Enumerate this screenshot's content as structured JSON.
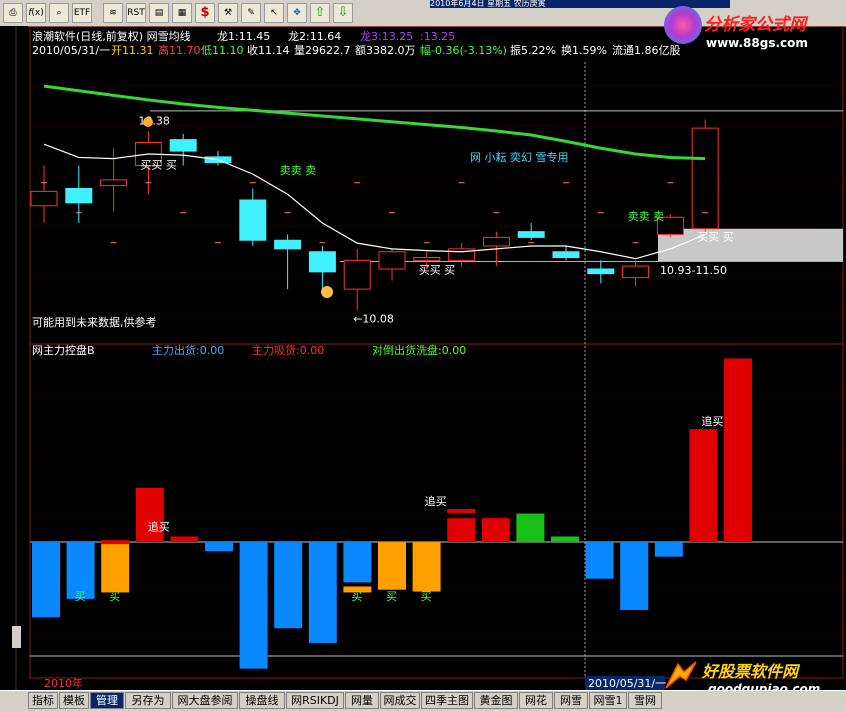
{
  "window": {
    "title": "2010年6月4日 星期五 农历庚寅"
  },
  "toolbar": {
    "icons": [
      "print-icon",
      "fx-icon",
      "search-icon",
      "etf-icon",
      "indicator-icon",
      "rst-icon",
      "data-icon",
      "dollar-icon",
      "tools-icon",
      "pen-icon",
      "arrow-icon",
      "move-icon",
      "up-arrow-icon",
      "down-arrow-icon"
    ],
    "etf_label": "ETF",
    "rst_label": "RST",
    "dollar_label": "$"
  },
  "header": {
    "row1": "浪潮软件(日线,前复权) 网雪均线",
    "long1": "龙1:11.45",
    "long2": "龙2:11.64",
    "long3": "龙3:13.25",
    "long4": ":13.25",
    "date": "2010/05/31/一",
    "open": "开11.31",
    "high": "高11.70",
    "low": "低11.10",
    "close": "收11.14",
    "volume": "量29622.7",
    "amount": "额3382.0万",
    "change": "幅-0.36(-3.13%)",
    "swing": "振5.22%",
    "turnover": "换1.59%",
    "float": "流通1.86亿股"
  },
  "annotations": {
    "future_note": "可能用到未来数据,供参考",
    "netname": "网 小耘 奕幻 雪专用",
    "high_mark": "13.38",
    "low_mark": "←10.08",
    "range_label": "10.93-11.50",
    "buy": "买",
    "sell": "卖",
    "chase": "追买"
  },
  "lower": {
    "title": "网主力控盘B",
    "out_label": "主力出货:0.00",
    "in_label": "主力吸货:0.00",
    "wash_label": "对倒出货洗盘:0.00"
  },
  "footer": {
    "year": "2010年",
    "cursor_date": "2010/05/31/一"
  },
  "tabs": [
    "指标",
    "模板",
    "管理",
    "另存为",
    "网大盘参阅",
    "操盘线",
    "网RSIKDJ",
    "网量",
    "网成交",
    "四季主图",
    "黄金图",
    "网花",
    "网雪",
    "网雪1",
    "雪网"
  ],
  "active_tab": "管理",
  "brands": {
    "top_name": "分析家公式网",
    "top_url": "www.88gs.com",
    "bottom_name": "好股票软件网",
    "bottom_url": "goodgupiao.com"
  },
  "colors": {
    "up": "#ff3030",
    "down": "#40f0ff",
    "ma_green": "#35d835",
    "line_white": "#ffffff",
    "bar_red": "#e00000",
    "bar_blue": "#0a88ff",
    "bar_orange": "#ffa000",
    "bar_green": "#18c018"
  },
  "chart_data": [
    {
      "type": "candlestick",
      "title": "浪潮软件(日线,前复权)",
      "ylim": [
        9.6,
        14.4
      ],
      "candles": [
        {
          "o": 11.9,
          "h": 12.6,
          "l": 11.6,
          "c": 12.15
        },
        {
          "o": 12.2,
          "h": 12.6,
          "l": 11.6,
          "c": 11.95
        },
        {
          "o": 12.25,
          "h": 12.9,
          "l": 11.8,
          "c": 12.35
        },
        {
          "o": 12.6,
          "h": 13.2,
          "l": 12.1,
          "c": 13.0
        },
        {
          "o": 13.05,
          "h": 13.15,
          "l": 12.6,
          "c": 12.85
        },
        {
          "o": 12.75,
          "h": 12.85,
          "l": 12.6,
          "c": 12.65
        },
        {
          "o": 12.0,
          "h": 12.2,
          "l": 11.2,
          "c": 11.3
        },
        {
          "o": 11.3,
          "h": 11.4,
          "l": 10.45,
          "c": 11.15
        },
        {
          "o": 11.1,
          "h": 11.2,
          "l": 10.4,
          "c": 10.75
        },
        {
          "o": 10.45,
          "h": 11.15,
          "l": 10.08,
          "c": 10.95
        },
        {
          "o": 10.8,
          "h": 11.15,
          "l": 10.6,
          "c": 11.1
        },
        {
          "o": 10.95,
          "h": 11.1,
          "l": 10.8,
          "c": 11.0
        },
        {
          "o": 10.95,
          "h": 11.25,
          "l": 10.85,
          "c": 11.15
        },
        {
          "o": 11.2,
          "h": 11.45,
          "l": 10.85,
          "c": 11.35
        },
        {
          "o": 11.45,
          "h": 11.6,
          "l": 11.3,
          "c": 11.35
        },
        {
          "o": 11.1,
          "h": 11.2,
          "l": 10.95,
          "c": 11.0
        },
        {
          "o": 10.8,
          "h": 10.95,
          "l": 10.55,
          "c": 10.72
        },
        {
          "o": 10.65,
          "h": 10.95,
          "l": 10.5,
          "c": 10.85
        },
        {
          "o": 11.4,
          "h": 11.75,
          "l": 11.35,
          "c": 11.7
        },
        {
          "o": 11.5,
          "h": 13.4,
          "l": 11.45,
          "c": 13.25
        }
      ],
      "series": [
        {
          "values": [
            12.97,
            12.74,
            12.72,
            12.8,
            12.78,
            12.7,
            12.45,
            12.1,
            11.6,
            11.25,
            11.15,
            11.12,
            11.1,
            11.15,
            11.2,
            11.2,
            11.1,
            10.98,
            11.15,
            11.4
          ]
        },
        {
          "values": [
            13.98,
            13.9,
            13.82,
            13.74,
            13.67,
            13.61,
            13.56,
            13.51,
            13.46,
            13.41,
            13.36,
            13.31,
            13.26,
            13.2,
            13.13,
            13.02,
            12.9,
            12.8,
            12.74,
            12.72
          ]
        }
      ],
      "reference_lines": [
        11.6,
        10.93,
        11.5
      ],
      "signals": [
        {
          "i": 3,
          "text": "买买 买",
          "price": 12.55
        },
        {
          "i": 7,
          "text": "卖卖 卖",
          "price": 12.45
        },
        {
          "i": 11,
          "text": "买买 买",
          "price": 10.72
        },
        {
          "i": 17,
          "text": "卖卖 卖",
          "price": 11.65
        },
        {
          "i": 19,
          "text": "买买 买",
          "price": 11.3
        }
      ],
      "high_point": {
        "i": 3,
        "value": 13.38
      },
      "low_point": {
        "i": 9,
        "value": 10.08
      },
      "gray_range": [
        10.93,
        11.5
      ]
    },
    {
      "type": "bar",
      "title": "网主力控盘B",
      "ylim": [
        -14,
        20
      ],
      "values": [
        -8.2,
        -6.2,
        -5.5,
        5.9,
        0.6,
        -1.0,
        -13.8,
        -9.4,
        -11.0,
        -4.4,
        -5.2,
        -5.4,
        2.6,
        2.6,
        3.1,
        0.6,
        -4.0,
        -7.4,
        -1.6,
        12.3,
        20.0
      ],
      "colors": [
        "blue",
        "blue",
        "orange",
        "red",
        "red",
        "blue",
        "blue",
        "blue",
        "blue",
        "blue",
        "orange",
        "orange",
        "red",
        "red",
        "green",
        "green",
        "blue",
        "blue",
        "blue",
        "red",
        "red"
      ],
      "secondary": [
        {
          "i": 9,
          "value": -5.5,
          "color": "orange"
        },
        {
          "i": 12,
          "value": 3.6,
          "color": "red"
        },
        {
          "i": 2,
          "value": 0.2,
          "color": "red"
        }
      ],
      "signal_labels": [
        {
          "i": 1,
          "text": "买"
        },
        {
          "i": 2,
          "text": "买"
        },
        {
          "i": 9,
          "text": "买"
        },
        {
          "i": 10,
          "text": "买"
        },
        {
          "i": 11,
          "text": "买"
        }
      ],
      "chase_labels": [
        {
          "i": 3,
          "value": 0.8
        },
        {
          "i": 11,
          "value": 3.6
        },
        {
          "i": 19,
          "value": 12.3
        }
      ]
    }
  ]
}
